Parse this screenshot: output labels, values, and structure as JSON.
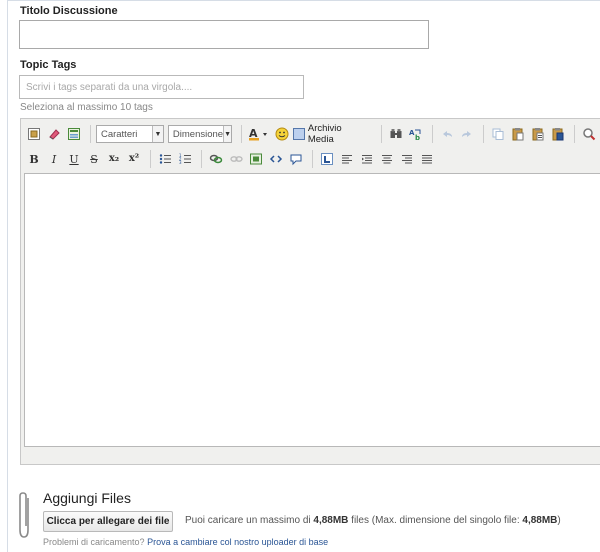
{
  "form": {
    "title_label": "Titolo Discussione",
    "title_value": "",
    "tags_label": "Topic Tags",
    "tags_placeholder": "Scrivi i tags separati da una virgola....",
    "tags_hint": "Seleziona al massimo 10 tags"
  },
  "editor": {
    "font_select": "Caratteri",
    "size_select": "Dimensione",
    "media_label": "Archivio Media",
    "icons_row1": [
      "source-icon",
      "eraser-icon",
      "template-icon",
      "font-family-select",
      "font-size-select",
      "text-color-icon",
      "emoticon-icon",
      "media-archive-icon",
      "find-icon",
      "replace-icon",
      "undo-icon",
      "redo-icon",
      "copy-icon",
      "paste-icon",
      "paste-text-icon",
      "paste-word-icon",
      "spellcheck-icon"
    ],
    "format_glyphs": {
      "bold": "B",
      "italic": "I",
      "underline": "U",
      "strike": "S",
      "subscript": "x₂",
      "superscript": "x²"
    },
    "content": ""
  },
  "attachments": {
    "title": "Aggiungi Files",
    "button_label": "Clicca per allegare dei file",
    "info_prefix": "Puoi caricare un massimo di ",
    "info_max": "4,88MB",
    "info_mid": " files (Max. dimensione del singolo file: ",
    "info_single": "4,88MB",
    "info_suffix": ")",
    "problems_text": "Problemi di caricamento?",
    "problems_link": "Prova a cambiare col nostro uploader di base"
  },
  "colors": {
    "link": "#2a5595",
    "toolbar_bg": "#f0f0ee",
    "border": "#a9a9a9"
  }
}
